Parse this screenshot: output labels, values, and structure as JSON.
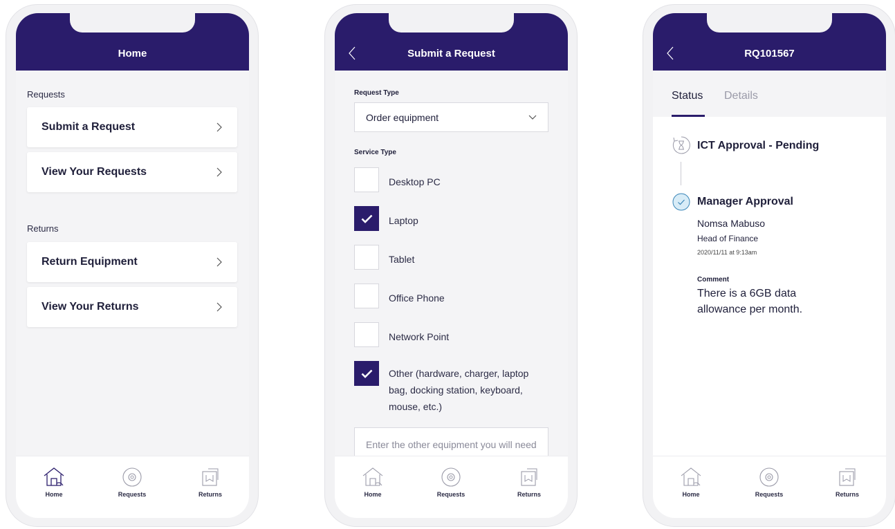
{
  "home": {
    "title": "Home",
    "requests_section": "Requests",
    "request_items": [
      "Submit a Request",
      "View Your Requests"
    ],
    "returns_section": "Returns",
    "return_items": [
      "Return Equipment",
      "View Your Returns"
    ]
  },
  "submit": {
    "title": "Submit a Request",
    "request_type_label": "Request Type",
    "request_type_value": "Order equipment",
    "service_type_label": "Service Type",
    "options": [
      {
        "label": "Desktop PC",
        "checked": false
      },
      {
        "label": "Laptop",
        "checked": true
      },
      {
        "label": "Tablet",
        "checked": false
      },
      {
        "label": "Office Phone",
        "checked": false
      },
      {
        "label": "Network Point",
        "checked": false
      },
      {
        "label": "Other (hardware, charger, laptop bag, docking station, keyboard, mouse, etc.)",
        "checked": true
      }
    ],
    "other_placeholder": "Enter the other equipment you will need"
  },
  "status": {
    "title": "RQ101567",
    "tab_status": "Status",
    "tab_details": "Details",
    "step1_title": "ICT Approval - Pending",
    "step2_title": "Manager Approval",
    "approver_name": "Nomsa Mabuso",
    "approver_role": "Head of Finance",
    "approved_at": "2020/11/11 at 9:13am",
    "comment_label": "Comment",
    "comment_text": "There is a 6GB data allowance per month."
  },
  "tabbar": {
    "home": "Home",
    "requests": "Requests",
    "returns": "Returns"
  },
  "colors": {
    "brand": "#2a1c6b",
    "approved_fill": "#d8ecf7",
    "approved_stroke": "#3a86b8"
  },
  "icons": [
    "house-icon",
    "gear-refresh-icon",
    "return-box-icon",
    "chevron-right-icon",
    "chevron-down-icon",
    "back-chevron-icon",
    "hourglass-icon",
    "check-circle-icon",
    "checkmark-icon"
  ]
}
